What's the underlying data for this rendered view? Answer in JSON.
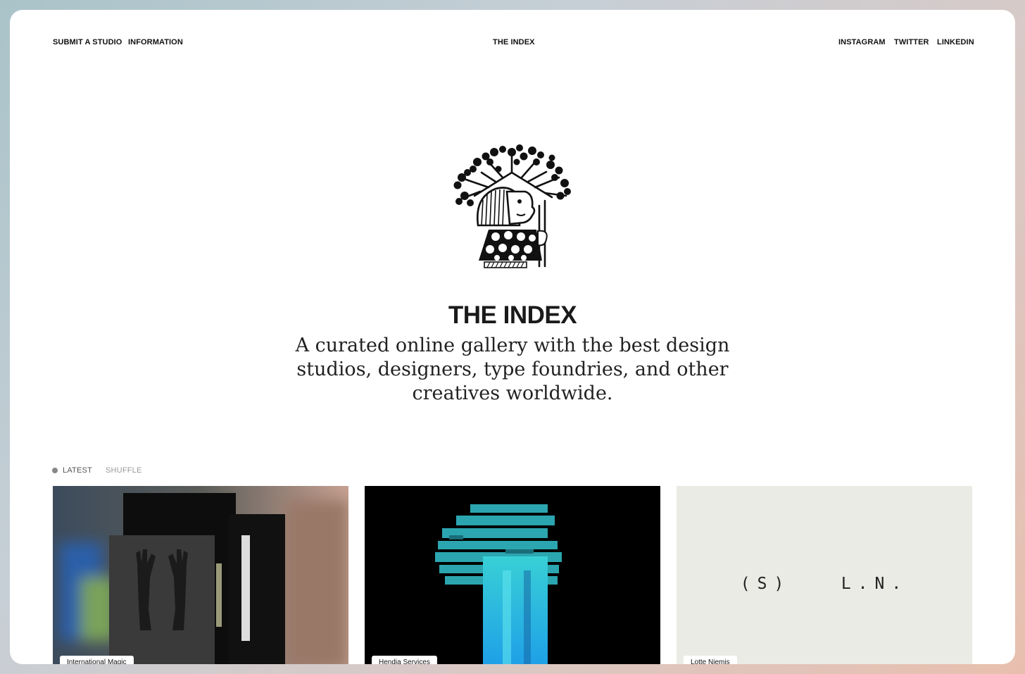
{
  "nav": {
    "left": [
      "SUBMIT A STUDIO",
      "INFORMATION"
    ],
    "center": "THE INDEX",
    "right": [
      "INSTAGRAM",
      "TWITTER",
      "LINKEDIN"
    ]
  },
  "hero": {
    "title": "THE INDEX",
    "subtitle": "A curated online gallery with the best design studios, designers, type foundries, and other creatives worldwide."
  },
  "filters": {
    "latest": "LATEST",
    "shuffle": "SHUFFLE",
    "active": "LATEST"
  },
  "cards": [
    {
      "label": "International Magic"
    },
    {
      "label": "Hendia Services"
    },
    {
      "label": "Lotte Niemis",
      "center_text": "(S)   L.N."
    }
  ],
  "colors": {
    "accent_dot": "#888888",
    "card2_highlight": "#33c3d6"
  }
}
